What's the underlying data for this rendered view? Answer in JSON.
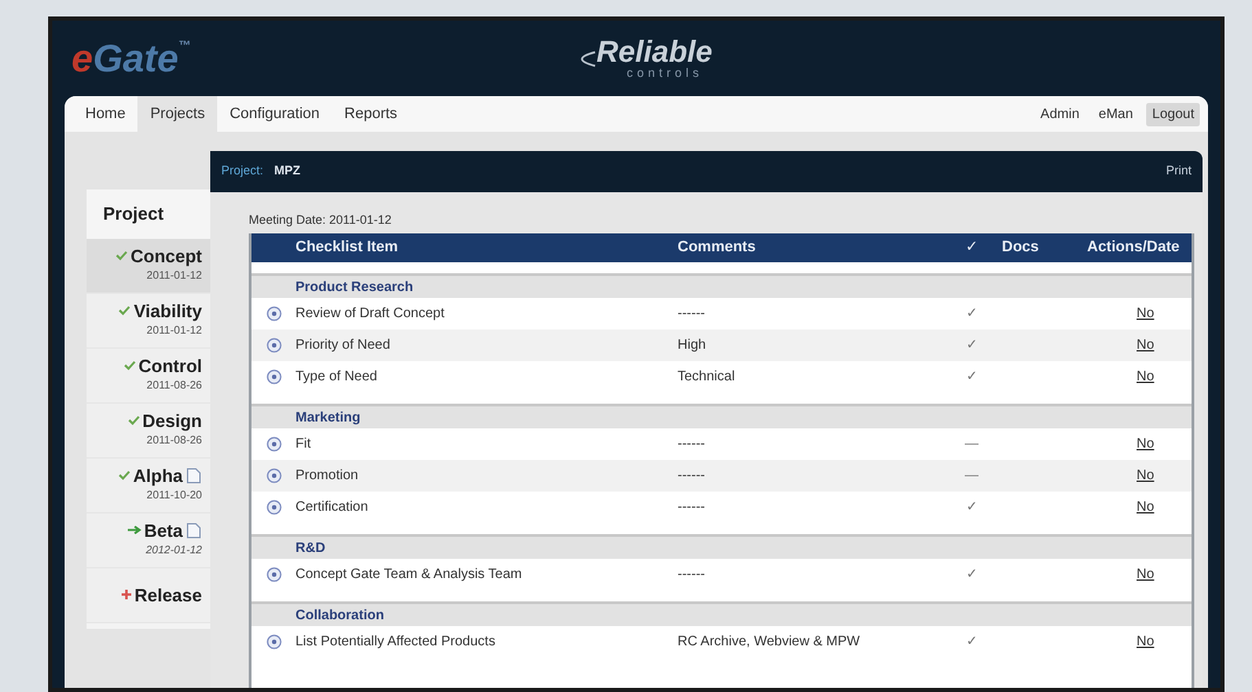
{
  "logo": {
    "e": "e",
    "name": "Gate",
    "tm": "™"
  },
  "brand": {
    "name": "Reliable",
    "sub": "controls"
  },
  "nav": {
    "tabs": [
      {
        "label": "Home",
        "selected": false
      },
      {
        "label": "Projects",
        "selected": true
      },
      {
        "label": "Configuration",
        "selected": false
      },
      {
        "label": "Reports",
        "selected": false
      }
    ],
    "user_links": [
      {
        "label": "Admin",
        "selected": false
      },
      {
        "label": "eMan",
        "selected": false
      },
      {
        "label": "Logout",
        "selected": true
      }
    ]
  },
  "sidebar": {
    "title": "Project",
    "stages": [
      {
        "name": "Concept",
        "date": "2011-01-12",
        "kind": "done",
        "doc": false,
        "selected": true
      },
      {
        "name": "Viability",
        "date": "2011-01-12",
        "kind": "done",
        "doc": false,
        "selected": false
      },
      {
        "name": "Control",
        "date": "2011-08-26",
        "kind": "done",
        "doc": false,
        "selected": false
      },
      {
        "name": "Design",
        "date": "2011-08-26",
        "kind": "done",
        "doc": false,
        "selected": false
      },
      {
        "name": "Alpha",
        "date": "2011-10-20",
        "kind": "done",
        "doc": true,
        "selected": false
      },
      {
        "name": "Beta",
        "date": "2012-01-12",
        "kind": "current",
        "doc": true,
        "selected": false
      },
      {
        "name": "Release",
        "kind": "pending",
        "doc": false,
        "selected": false
      }
    ]
  },
  "project_bar": {
    "label": "Project:",
    "value": "MPZ",
    "print": "Print"
  },
  "meeting_date": "Meeting Date: 2011-01-12",
  "table": {
    "columns": [
      "Checklist Item",
      "Comments",
      "✓",
      "Docs",
      "Actions/Date"
    ],
    "groups": [
      {
        "title": "Product Research",
        "rows": [
          {
            "item": "Review of Draft Concept",
            "comment": "------",
            "check": "✓",
            "action": "No"
          },
          {
            "item": "Priority of Need",
            "comment": "High",
            "check": "✓",
            "action": "No"
          },
          {
            "item": "Type of Need",
            "comment": "Technical",
            "check": "✓",
            "action": "No"
          }
        ]
      },
      {
        "title": "Marketing",
        "rows": [
          {
            "item": "Fit",
            "comment": "------",
            "check": "—",
            "action": "No"
          },
          {
            "item": "Promotion",
            "comment": "------",
            "check": "—",
            "action": "No"
          },
          {
            "item": "Certification",
            "comment": "------",
            "check": "✓",
            "action": "No"
          }
        ]
      },
      {
        "title": "R&D",
        "rows": [
          {
            "item": "Concept Gate Team & Analysis Team",
            "comment": "------",
            "check": "✓",
            "action": "No"
          }
        ]
      },
      {
        "title": "Collaboration",
        "rows": [
          {
            "item": "List Potentially Affected Products",
            "comment": "RC Archive, Webview & MPW",
            "check": "✓",
            "action": "No"
          }
        ]
      }
    ]
  }
}
